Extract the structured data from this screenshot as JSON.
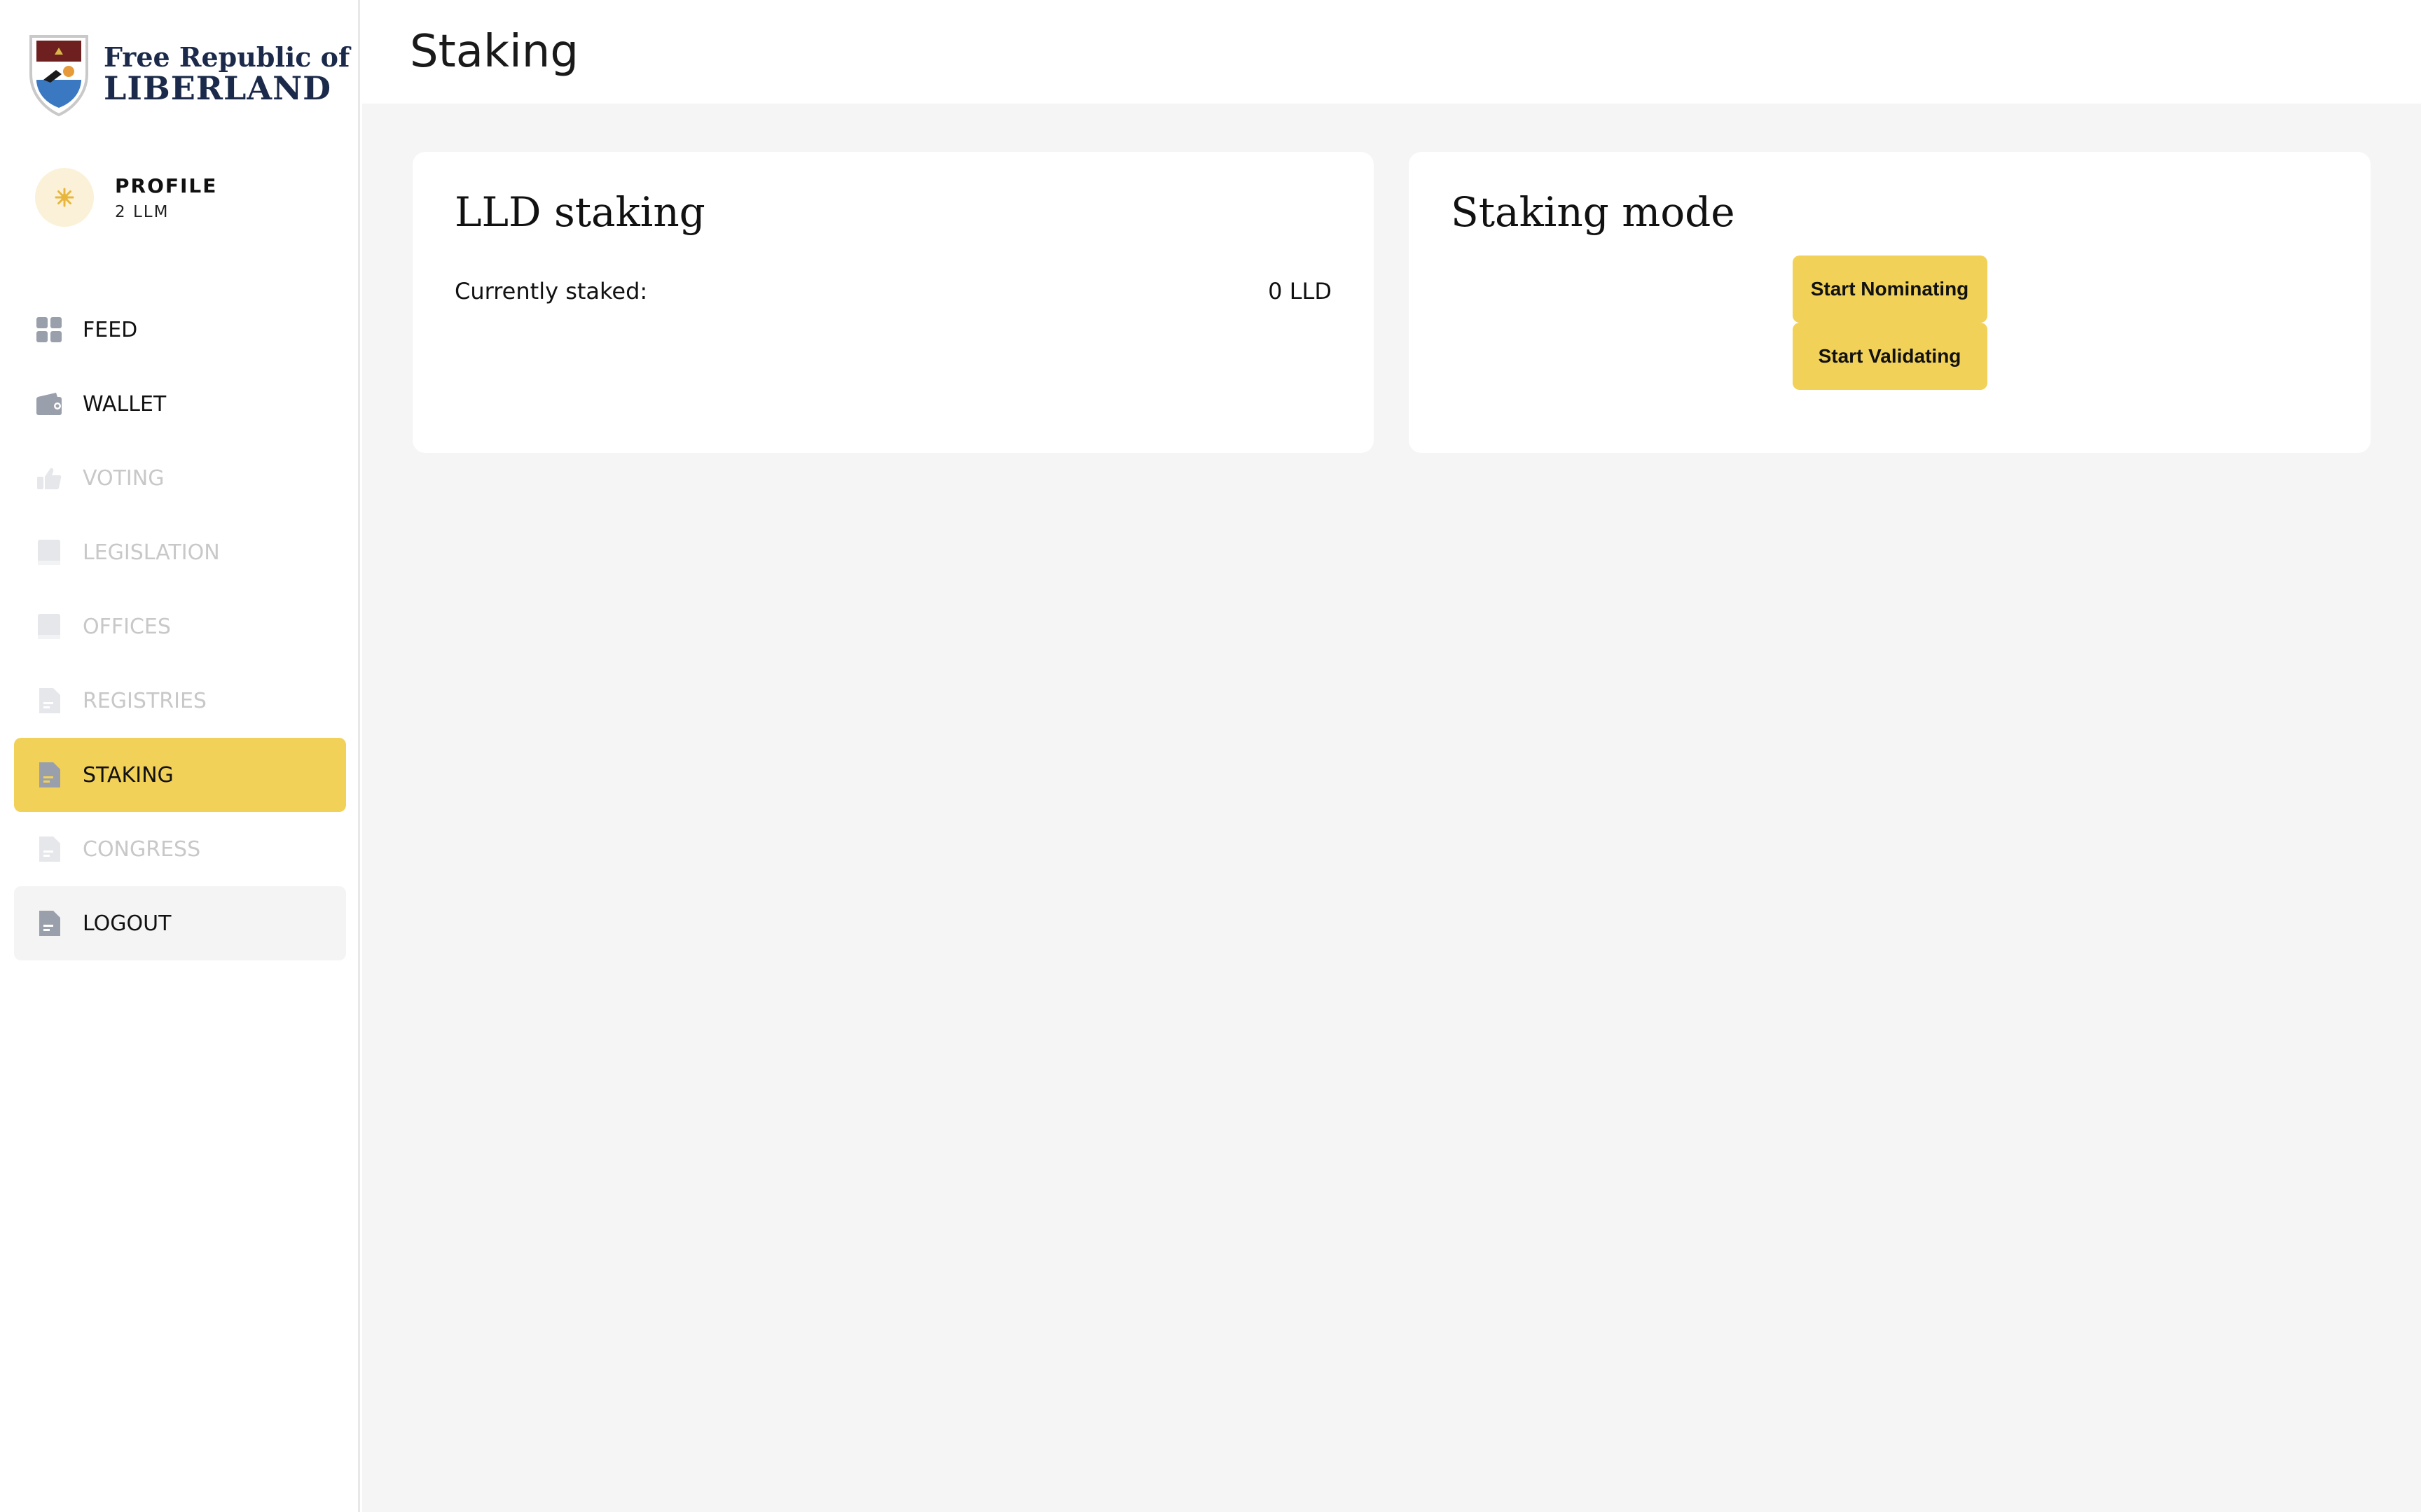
{
  "logo": {
    "line1": "Free Republic of",
    "line2": "LIBERLAND"
  },
  "profile": {
    "name": "PROFILE",
    "balance": "2 LLM"
  },
  "nav": {
    "items": [
      {
        "label": "FEED",
        "icon": "grid-icon",
        "state": "enabled"
      },
      {
        "label": "WALLET",
        "icon": "wallet-icon",
        "state": "enabled"
      },
      {
        "label": "VOTING",
        "icon": "thumbs-up-icon",
        "state": "disabled"
      },
      {
        "label": "LEGISLATION",
        "icon": "book-icon",
        "state": "disabled"
      },
      {
        "label": "OFFICES",
        "icon": "book-icon",
        "state": "disabled"
      },
      {
        "label": "REGISTRIES",
        "icon": "document-icon",
        "state": "disabled"
      },
      {
        "label": "STAKING",
        "icon": "document-icon",
        "state": "active"
      },
      {
        "label": "CONGRESS",
        "icon": "document-icon",
        "state": "disabled"
      },
      {
        "label": "LOGOUT",
        "icon": "document-icon",
        "state": "logout"
      }
    ]
  },
  "header": {
    "title": "Staking"
  },
  "lld_staking": {
    "title": "LLD staking",
    "currently_staked_label": "Currently staked:",
    "currently_staked_value": "0 LLD"
  },
  "staking_mode": {
    "title": "Staking mode",
    "start_nominating_label": "Start Nominating",
    "start_validating_label": "Start Validating"
  },
  "colors": {
    "accent": "#f2d159",
    "main_bg": "#f5f5f5",
    "disabled_text": "#c8c8c8",
    "icon_gray": "#9aa0ab"
  }
}
